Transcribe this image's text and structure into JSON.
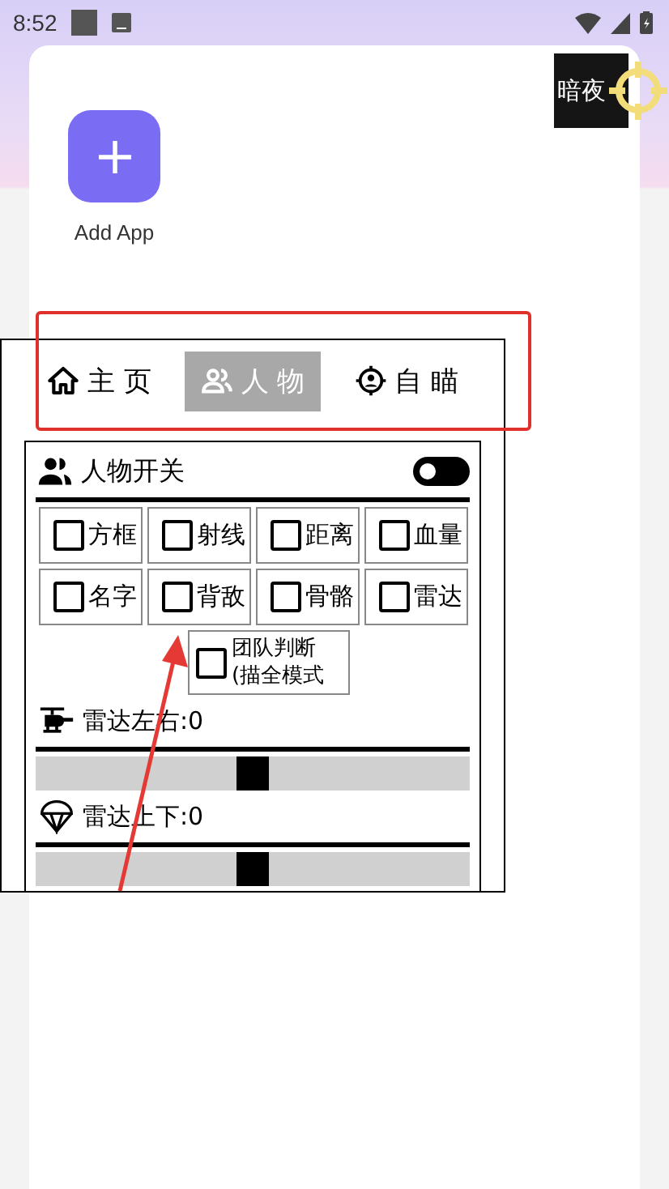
{
  "status_bar": {
    "time": "8:52"
  },
  "floating_badge": {
    "label": "暗夜"
  },
  "apps": [
    {
      "label": "Add App"
    }
  ],
  "overlay": {
    "tabs": [
      {
        "label": "主 页",
        "selected": false
      },
      {
        "label": "人 物",
        "selected": true
      },
      {
        "label": "自 瞄",
        "selected": false
      }
    ],
    "section": {
      "title": "人物开关",
      "on": false
    },
    "options": [
      {
        "label": "方框",
        "checked": false
      },
      {
        "label": "射线",
        "checked": false
      },
      {
        "label": "距离",
        "checked": false
      },
      {
        "label": "血量",
        "checked": false
      },
      {
        "label": "名字",
        "checked": false
      },
      {
        "label": "背敌",
        "checked": false
      },
      {
        "label": "骨骼",
        "checked": false
      },
      {
        "label": "雷达",
        "checked": false
      },
      {
        "label": "团队判断 (描全模式",
        "checked": false
      }
    ],
    "sliders": [
      {
        "label": "雷达左右:0",
        "level": 0.5
      },
      {
        "label": "雷达上下:0",
        "level": 0.5
      }
    ]
  }
}
